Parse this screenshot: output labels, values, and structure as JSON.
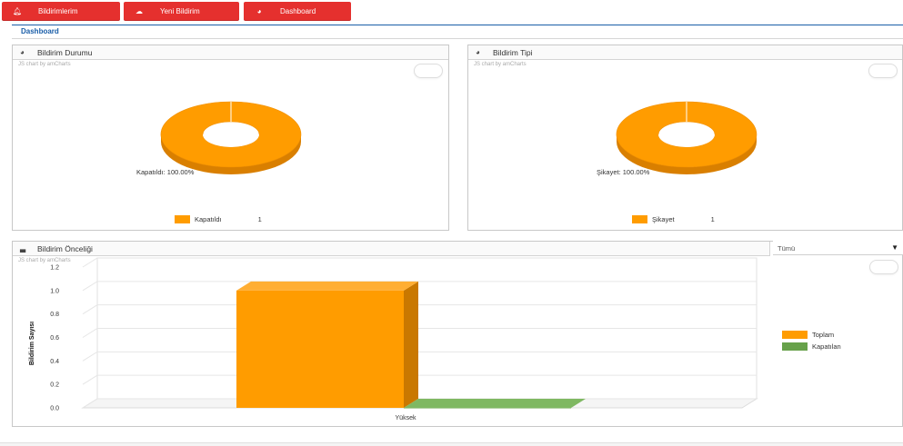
{
  "tabs": [
    {
      "label": "Bildirimlerim",
      "icon": "bell-icon"
    },
    {
      "label": "Yeni Bildirim",
      "icon": "comment-icon"
    },
    {
      "label": "Dashboard",
      "icon": "pie-icon"
    }
  ],
  "page": {
    "title": "Dashboard"
  },
  "colors": {
    "accent": "#e5302e",
    "orange": "#ff9c00",
    "green": "#67a14a"
  },
  "panels": {
    "status": {
      "title": "Bildirim Durumu",
      "credit": "JS chart by amCharts",
      "slice_label": "Kapatıldı: 100.00%",
      "legend": {
        "label": "Kapatıldı",
        "value": "1"
      }
    },
    "type": {
      "title": "Bildirim Tipi",
      "credit": "JS chart by amCharts",
      "slice_label": "Şikayet: 100.00%",
      "legend": {
        "label": "Şikayet",
        "value": "1"
      }
    },
    "priority": {
      "title": "Bildirim Önceliği",
      "credit": "JS chart by amCharts"
    }
  },
  "filter": {
    "selected": "Tümü"
  },
  "chart_data": [
    {
      "type": "pie",
      "categories": [
        "Kapatıldı"
      ],
      "values": [
        1
      ],
      "percent_labels": [
        "100.00%"
      ],
      "legend_position": "bottom"
    },
    {
      "type": "pie",
      "categories": [
        "Şikayet"
      ],
      "values": [
        1
      ],
      "percent_labels": [
        "100.00%"
      ],
      "legend_position": "bottom"
    },
    {
      "type": "bar",
      "categories": [
        "Yüksek"
      ],
      "series": [
        {
          "name": "Toplam",
          "values": [
            1
          ]
        },
        {
          "name": "Kapatılan",
          "values": [
            0
          ]
        }
      ],
      "ylabel": "Bildirim Sayısı",
      "ylim": [
        0,
        1.2
      ],
      "yticks": [
        "0.0",
        "0.2",
        "0.4",
        "0.6",
        "0.8",
        "1.0",
        "1.2"
      ],
      "grid": true,
      "legend_position": "right"
    }
  ]
}
